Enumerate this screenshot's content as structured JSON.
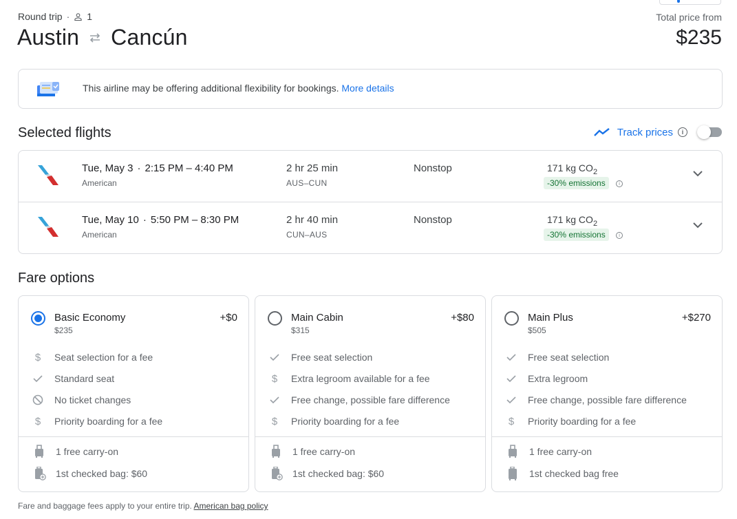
{
  "header": {
    "trip_type": "Round trip",
    "separator": "·",
    "passengers": "1",
    "origin": "Austin",
    "destination": "Cancún",
    "price_label": "Total price from",
    "price": "$235"
  },
  "banner": {
    "text": "This airline may be offering additional flexibility for bookings.",
    "link": "More details"
  },
  "selected_flights": {
    "title": "Selected flights",
    "track_prices_label": "Track prices",
    "track_prices_on": false,
    "flights": [
      {
        "date": "Tue, May 3",
        "times": "2:15 PM – 4:40 PM",
        "airline": "American",
        "duration": "2 hr 25 min",
        "route": "AUS–CUN",
        "stops": "Nonstop",
        "co2_value": "171 kg CO",
        "co2_sub": "2",
        "emissions_badge": "-30% emissions"
      },
      {
        "date": "Tue, May 10",
        "times": "5:50 PM – 8:30 PM",
        "airline": "American",
        "duration": "2 hr 40 min",
        "route": "CUN–AUS",
        "stops": "Nonstop",
        "co2_value": "171 kg CO",
        "co2_sub": "2",
        "emissions_badge": "-30% emissions"
      }
    ]
  },
  "fare_options": {
    "title": "Fare options",
    "fares": [
      {
        "name": "Basic Economy",
        "total": "$235",
        "delta": "+$0",
        "selected": true,
        "features": [
          {
            "icon": "dollar-icon",
            "text": "Seat selection for a fee"
          },
          {
            "icon": "check-icon",
            "text": "Standard seat"
          },
          {
            "icon": "no-icon",
            "text": "No ticket changes"
          },
          {
            "icon": "dollar-icon",
            "text": "Priority boarding for a fee"
          }
        ],
        "bags": [
          {
            "icon": "carry-on-icon",
            "text": "1 free carry-on"
          },
          {
            "icon": "checked-bag-fee-icon",
            "text": "1st checked bag: $60"
          }
        ]
      },
      {
        "name": "Main Cabin",
        "total": "$315",
        "delta": "+$80",
        "selected": false,
        "features": [
          {
            "icon": "check-icon",
            "text": "Free seat selection"
          },
          {
            "icon": "dollar-icon",
            "text": "Extra legroom available for a fee"
          },
          {
            "icon": "check-icon",
            "text": "Free change, possible fare difference"
          },
          {
            "icon": "dollar-icon",
            "text": "Priority boarding for a fee"
          }
        ],
        "bags": [
          {
            "icon": "carry-on-icon",
            "text": "1 free carry-on"
          },
          {
            "icon": "checked-bag-fee-icon",
            "text": "1st checked bag: $60"
          }
        ]
      },
      {
        "name": "Main Plus",
        "total": "$505",
        "delta": "+$270",
        "selected": false,
        "features": [
          {
            "icon": "check-icon",
            "text": "Free seat selection"
          },
          {
            "icon": "check-icon",
            "text": "Extra legroom"
          },
          {
            "icon": "check-icon",
            "text": "Free change, possible fare difference"
          },
          {
            "icon": "dollar-icon",
            "text": "Priority boarding for a fee"
          }
        ],
        "bags": [
          {
            "icon": "carry-on-icon",
            "text": "1 free carry-on"
          },
          {
            "icon": "checked-bag-icon",
            "text": "1st checked bag free"
          }
        ]
      }
    ]
  },
  "footnote": {
    "text": "Fare and baggage fees apply to your entire trip.",
    "link": "American bag policy"
  },
  "colors": {
    "accent": "#1a73e8",
    "emissions_bg": "#e6f4ea",
    "emissions_text": "#137333"
  }
}
